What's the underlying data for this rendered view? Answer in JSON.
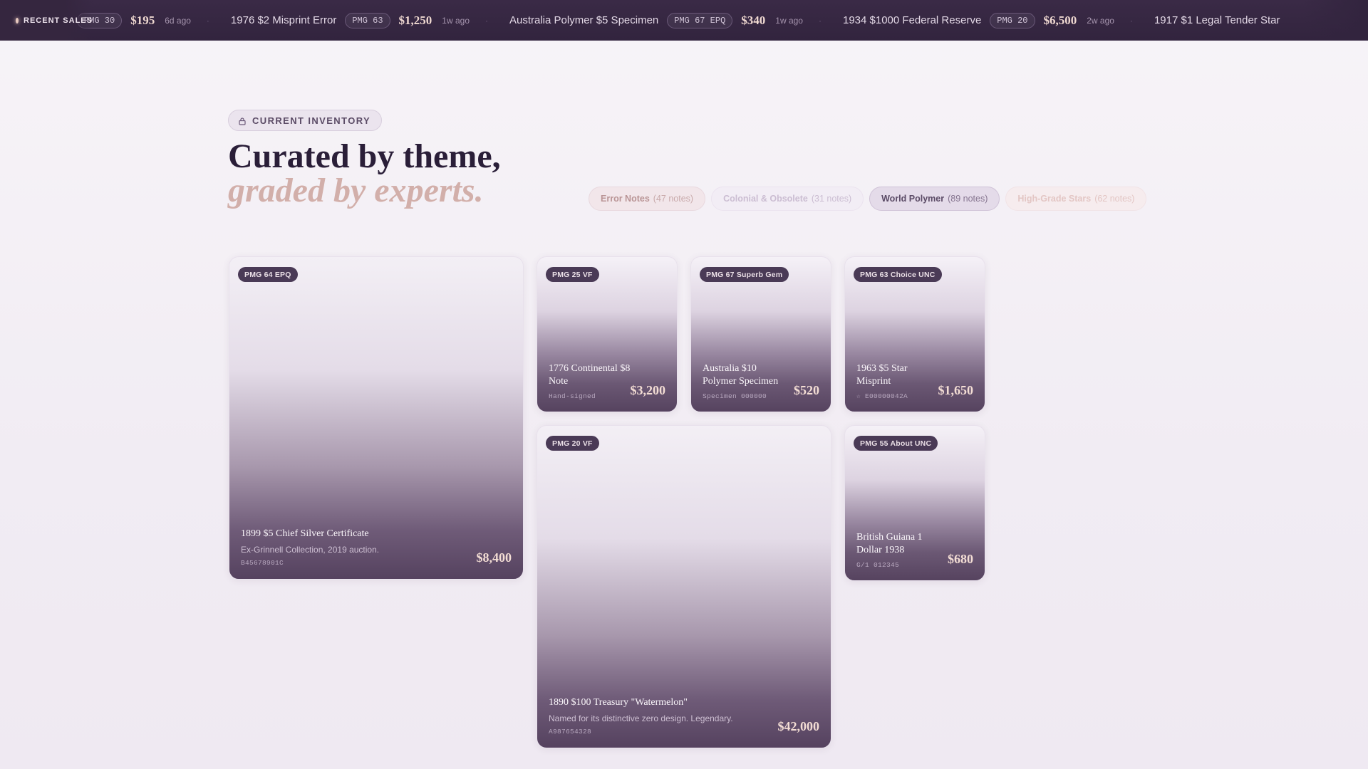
{
  "ticker": {
    "label": "RECENT SALES",
    "items": [
      {
        "name": "",
        "grade": "PMG 30",
        "price": "$195",
        "time": "6d ago"
      },
      {
        "name": "1976 $2 Misprint Error",
        "grade": "PMG 63",
        "price": "$1,250",
        "time": "1w ago"
      },
      {
        "name": "Australia Polymer $5 Specimen",
        "grade": "PMG 67 EPQ",
        "price": "$340",
        "time": "1w ago"
      },
      {
        "name": "1934 $1000 Federal Reserve",
        "grade": "PMG 20",
        "price": "$6,500",
        "time": "2w ago"
      },
      {
        "name": "1917 $1 Legal Tender Star",
        "grade": "",
        "price": "",
        "time": ""
      }
    ]
  },
  "section": {
    "label": "CURRENT INVENTORY",
    "headline_line1": "Curated by theme,",
    "headline_line2": "graded by experts."
  },
  "filters": [
    {
      "label": "Error Notes",
      "count": "(47 notes)",
      "state": "default"
    },
    {
      "label": "Colonial & Obsolete",
      "count": "(31 notes)",
      "state": "faded"
    },
    {
      "label": "World Polymer",
      "count": "(89 notes)",
      "state": "active"
    },
    {
      "label": "High-Grade Stars",
      "count": "(62 notes)",
      "state": "faded"
    }
  ],
  "cards": [
    {
      "grade": "PMG 64 EPQ",
      "title": "1899 $5 Chief Silver Certificate",
      "desc": "Ex-Grinnell Collection, 2019 auction.",
      "serial": "B45678901C",
      "price": "$8,400"
    },
    {
      "grade": "PMG 25 VF",
      "title": "1776 Continental $8 Note",
      "desc": "",
      "serial": "Hand-signed",
      "price": "$3,200"
    },
    {
      "grade": "PMG 67 Superb Gem",
      "title": "Australia $10 Polymer Specimen",
      "desc": "",
      "serial": "Specimen 000000",
      "price": "$520"
    },
    {
      "grade": "PMG 63 Choice UNC",
      "title": "1963 $5 Star Misprint",
      "desc": "",
      "serial": "☆ E00000042A",
      "price": "$1,650"
    },
    {
      "grade": "PMG 20 VF",
      "title": "1890 $100 Treasury \"Watermelon\"",
      "desc": "Named for its distinctive zero design. Legendary.",
      "serial": "A987654328",
      "price": "$42,000"
    },
    {
      "grade": "PMG 55 About UNC",
      "title": "British Guiana 1 Dollar 1938",
      "desc": "",
      "serial": "G/1 012345",
      "price": "$680"
    }
  ]
}
